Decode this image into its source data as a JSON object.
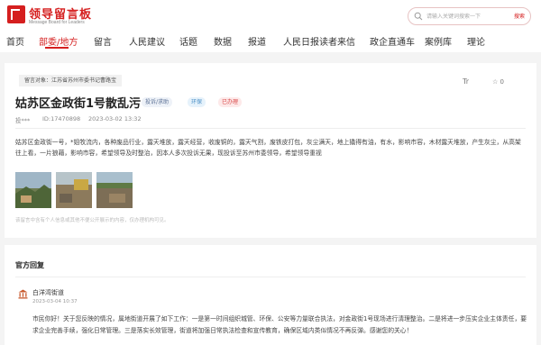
{
  "brand": {
    "name": "领导留言板",
    "tagline": "Message Board for Leaders",
    "color": "#d51f1f"
  },
  "search": {
    "placeholder": "请输入关键词搜索一下",
    "button": "搜索"
  },
  "nav": [
    {
      "label": "首页",
      "active": false
    },
    {
      "label": "部委/地方",
      "active": true
    },
    {
      "label": "留言",
      "active": false
    },
    {
      "label": "人民建议",
      "active": false
    },
    {
      "label": "话题",
      "active": false
    },
    {
      "label": "数据",
      "active": false
    },
    {
      "label": "报道",
      "active": false
    },
    {
      "label": "人民日报读者来信",
      "active": false
    },
    {
      "label": "政企直通车",
      "active": false
    },
    {
      "label": "案例库",
      "active": false
    },
    {
      "label": "理论",
      "active": false
    }
  ],
  "message": {
    "target": "留言对象：江苏省苏州市委书记曹路宝",
    "translate": "Tr",
    "likes": "☆ 0",
    "title": "姑苏区金政街1号散乱污",
    "tags": [
      "投诉/求助",
      "环保",
      "已办理"
    ],
    "author": "投***",
    "id": "ID:17470898",
    "date": "2023-03-02 13:32",
    "content": "姑苏区金政街一号，*姐牧流内，各种废品行业，露天堆放，露天经营，收废铜的，露天气割，废铁皮打包，灰尘满天，地上撬得有油，有水，影响市容，木材露天堆放，产生灰尘，从高架往上看，一片狼藉，影响市容，希望领导及时整治，因本人多次投诉无果，现投诉至苏州市委领导，希望领导重视",
    "photos": [
      "photo-1",
      "photo-2",
      "photo-3"
    ],
    "disclaimer": "该留言中含有个人信息或其他不便公开展示的内容，仅办理机构可见。"
  },
  "reply": {
    "heading": "官方回复",
    "org": "白洋湾街道",
    "date": "2023-03-04 10:37",
    "text": "市民你好！关于您反映的情况，属地街道开展了如下工作：一是第一时间组织城管、环保、公安等力量联合执法，对金政街1号现场进行清理整治。二是将进一步压实企业主体责任，要求企业完善手续，强化日常管理。三是落实长效管理，街道将加强日常执法检查和宣传教育，确保区域内类似情况不再反弹。感谢您的关心！"
  }
}
